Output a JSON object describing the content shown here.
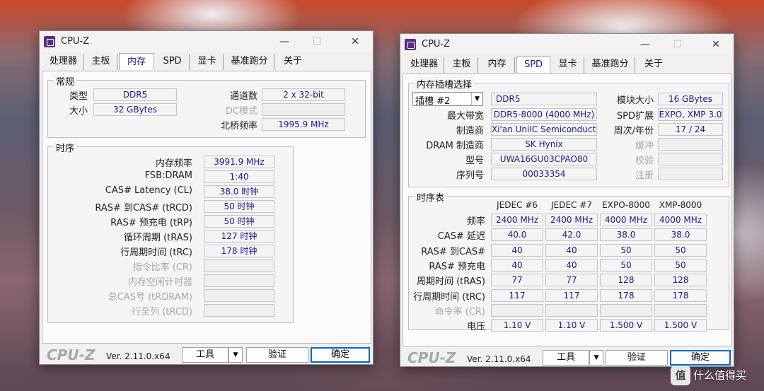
{
  "left_window": {
    "title": "CPU-Z",
    "tabs": [
      "处理器",
      "主板",
      "内存",
      "SPD",
      "显卡",
      "基准跑分",
      "关于"
    ],
    "active_tab": "内存",
    "general": {
      "title": "常规",
      "type_label": "类型",
      "type_value": "DDR5",
      "size_label": "大小",
      "size_value": "32 GBytes",
      "channels_label": "通道数",
      "channels_value": "2 x 32-bit",
      "dc_mode_label": "DC模式",
      "dc_mode_value": "",
      "nb_freq_label": "北桥频率",
      "nb_freq_value": "1995.9 MHz"
    },
    "timings": {
      "title": "时序",
      "rows": [
        {
          "label": "内存频率",
          "value": "3991.9 MHz",
          "enabled": true
        },
        {
          "label": "FSB:DRAM",
          "value": "1:40",
          "enabled": true
        },
        {
          "label": "CAS# Latency (CL)",
          "value": "38.0 时钟",
          "enabled": true
        },
        {
          "label": "RAS# 到CAS# (tRCD)",
          "value": "50 时钟",
          "enabled": true
        },
        {
          "label": "RAS# 预充电 (tRP)",
          "value": "50 时钟",
          "enabled": true
        },
        {
          "label": "循环周期 (tRAS)",
          "value": "127 时钟",
          "enabled": true
        },
        {
          "label": "行周期时间 (tRC)",
          "value": "178 时钟",
          "enabled": true
        },
        {
          "label": "指令比率 (CR)",
          "value": "",
          "enabled": false
        },
        {
          "label": "内存空闲计时器",
          "value": "",
          "enabled": false
        },
        {
          "label": "总CAS号 (tRDRAM)",
          "value": "",
          "enabled": false
        },
        {
          "label": "行至列 (tRCD)",
          "value": "",
          "enabled": false
        }
      ]
    },
    "footer": {
      "logo": "CPU-Z",
      "version": "Ver. 2.11.0.x64",
      "tools_label": "工具",
      "validate_label": "验证",
      "ok_label": "确定"
    }
  },
  "right_window": {
    "title": "CPU-Z",
    "tabs": [
      "处理器",
      "主板",
      "内存",
      "SPD",
      "显卡",
      "基准跑分",
      "关于"
    ],
    "active_tab": "SPD",
    "slot_group": {
      "title": "内存插槽选择",
      "slot_selected": "插槽 #2",
      "type_value": "DDR5",
      "max_bw_label": "最大带宽",
      "max_bw_value": "DDR5-8000 (4000 MHz)",
      "manufacturer_label": "制造商",
      "manufacturer_value": "Xi'an UniIC Semiconductors",
      "dram_mfr_label": "DRAM 制造商",
      "dram_mfr_value": "SK Hynix",
      "model_label": "型号",
      "model_value": "UWA16GU03CPAO80",
      "serial_label": "序列号",
      "serial_value": "00033354",
      "module_size_label": "模块大小",
      "module_size_value": "16 GBytes",
      "spd_ext_label": "SPD扩展",
      "spd_ext_value": "EXPO, XMP 3.0",
      "week_year_label": "周次/年份",
      "week_year_value": "17 / 24",
      "buffered_label": "缓冲",
      "buffered_value": "",
      "correction_label": "校验",
      "correction_value": "",
      "registered_label": "注册",
      "registered_value": ""
    },
    "timing_table": {
      "title": "时序表",
      "columns": [
        "JEDEC #6",
        "JEDEC #7",
        "EXPO-8000",
        "XMP-8000"
      ],
      "rows": [
        {
          "label": "频率",
          "values": [
            "2400 MHz",
            "2400 MHz",
            "4000 MHz",
            "4000 MHz"
          ],
          "enabled": true
        },
        {
          "label": "CAS# 延迟",
          "values": [
            "40.0",
            "42.0",
            "38.0",
            "38.0"
          ],
          "enabled": true
        },
        {
          "label": "RAS# 到CAS#",
          "values": [
            "40",
            "40",
            "50",
            "50"
          ],
          "enabled": true
        },
        {
          "label": "RAS# 预充电",
          "values": [
            "40",
            "40",
            "50",
            "50"
          ],
          "enabled": true
        },
        {
          "label": "周期时间 (tRAS)",
          "values": [
            "77",
            "77",
            "128",
            "128"
          ],
          "enabled": true
        },
        {
          "label": "行周期时间 (tRC)",
          "values": [
            "117",
            "117",
            "178",
            "178"
          ],
          "enabled": true
        },
        {
          "label": "命令率 (CR)",
          "values": [
            "",
            "",
            "",
            ""
          ],
          "enabled": false
        },
        {
          "label": "电压",
          "values": [
            "1.10 V",
            "1.10 V",
            "1.500 V",
            "1.500 V"
          ],
          "enabled": true
        }
      ]
    },
    "footer": {
      "logo": "CPU-Z",
      "version": "Ver. 2.11.0.x64",
      "tools_label": "工具",
      "validate_label": "验证",
      "ok_label": "确定"
    }
  },
  "watermark": {
    "icon_text": "值",
    "text": "什么值得买"
  }
}
